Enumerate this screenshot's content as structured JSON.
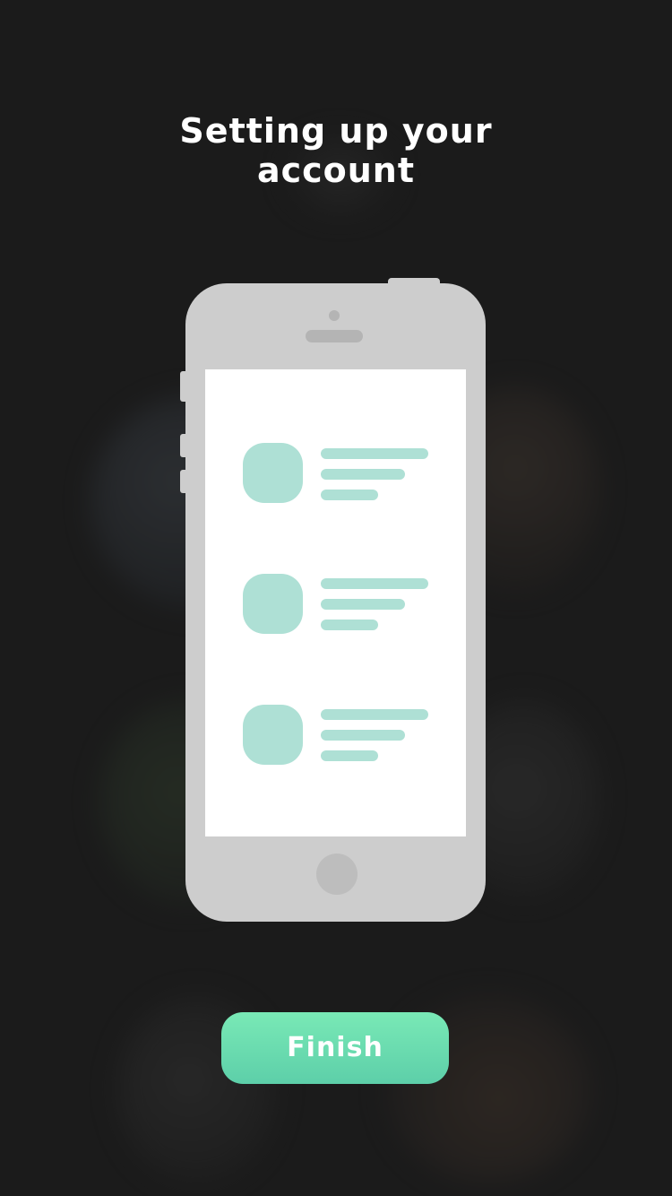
{
  "header": {
    "title_line1": "Setting up your",
    "title_line2": "account"
  },
  "illustration": {
    "list_items": 3,
    "accent_color": "#aee0d5",
    "phone_color": "#cdcdcd"
  },
  "actions": {
    "finish_label": "Finish",
    "finish_color": "#6ad9ae"
  },
  "colors": {
    "background": "#1b1b1b",
    "text": "#ffffff"
  }
}
